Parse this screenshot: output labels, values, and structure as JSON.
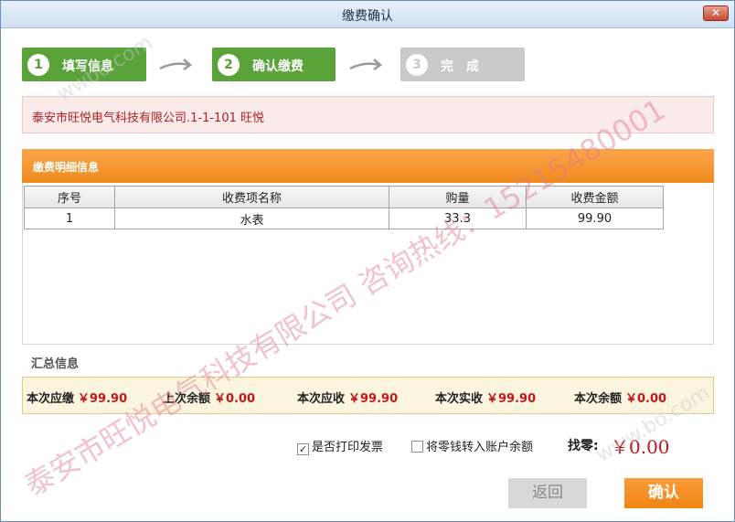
{
  "window": {
    "title": "缴费确认",
    "close_label": "✕"
  },
  "steps": [
    {
      "num": "1",
      "label": "填写信息"
    },
    {
      "num": "2",
      "label": "确认缴费"
    },
    {
      "num": "3",
      "label": "完　成"
    }
  ],
  "address": "泰安市旺悦电气科技有限公司.1-1-101 旺悦",
  "detail": {
    "title": "缴费明细信息",
    "columns": [
      "序号",
      "收费项名称",
      "购量",
      "收费金额"
    ],
    "rows": [
      {
        "index": "1",
        "name": "水表",
        "quantity": "33.3",
        "amount": "99.90"
      }
    ]
  },
  "summary": {
    "title": "汇总信息",
    "items": [
      {
        "key": "本次应缴",
        "value": "￥99.90"
      },
      {
        "key": "上次余额",
        "value": "￥0.00"
      },
      {
        "key": "本次应收",
        "value": "￥99.90"
      },
      {
        "key": "本次实收",
        "value": "￥99.90"
      },
      {
        "key": "本次余额",
        "value": "￥0.00"
      }
    ]
  },
  "options": {
    "print_invoice": {
      "label": "是否打印发票",
      "checked": true,
      "mark": "✓"
    },
    "transfer_change": {
      "label": "将零钱转入账户余额",
      "checked": false,
      "mark": ""
    }
  },
  "change": {
    "label": "找零:",
    "value": "￥0.00"
  },
  "buttons": {
    "back": "返回",
    "confirm": "确认"
  },
  "watermarks": {
    "main": "泰安市旺悦电气科技有限公司 咨询热线：15215480001",
    "faint_top": "wwbo.com",
    "faint_bottom": "www.bo.com"
  },
  "colors": {
    "step_active": "#5aa33a",
    "step_inactive": "#c9c9c9",
    "accent": "#f08a1d",
    "money": "#c01818"
  }
}
